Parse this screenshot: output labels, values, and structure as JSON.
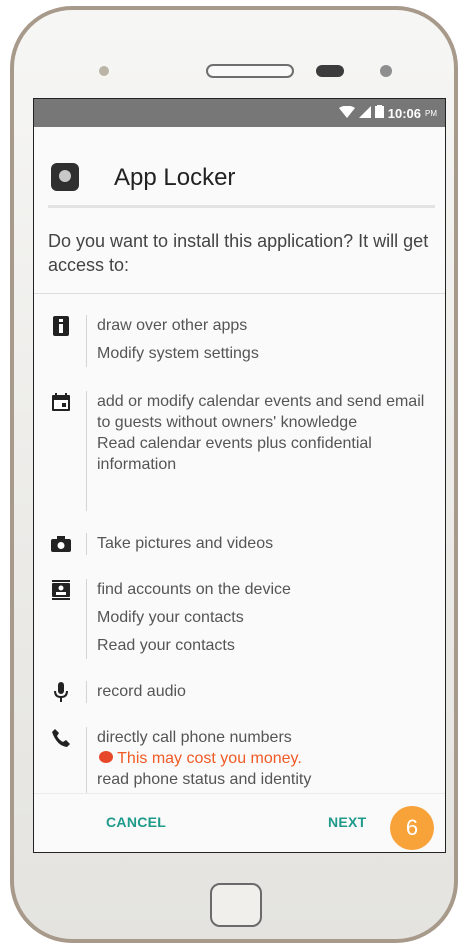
{
  "status_bar": {
    "time": "10:06",
    "ampm": "PM"
  },
  "dialog": {
    "app_name": "App Locker",
    "question": "Do you want to install this application? It will get access to:",
    "permissions": [
      {
        "icon": "info-icon",
        "lines": [
          "draw over other apps",
          "Modify system settings"
        ]
      },
      {
        "icon": "calendar-icon",
        "lines": [
          "add or modify calendar events and send email to guests without owners' knowledge",
          "Read calendar events plus confidential information"
        ]
      },
      {
        "icon": "camera-icon",
        "lines": [
          "Take pictures and videos"
        ]
      },
      {
        "icon": "contacts-icon",
        "lines": [
          "find accounts on the device",
          "Modify your contacts",
          "Read your contacts"
        ]
      },
      {
        "icon": "microphone-icon",
        "lines": [
          "record audio"
        ]
      },
      {
        "icon": "phone-icon",
        "lines": [
          "directly call phone numbers"
        ],
        "warning": "This may cost you money.",
        "extra": "read phone status and identity"
      }
    ],
    "cancel_label": "CANCEL",
    "next_label": "NEXT"
  },
  "step_badge": "6",
  "colors": {
    "accent": "#1f9a8a",
    "warning": "#f05a24",
    "badge": "#f7a33a"
  }
}
